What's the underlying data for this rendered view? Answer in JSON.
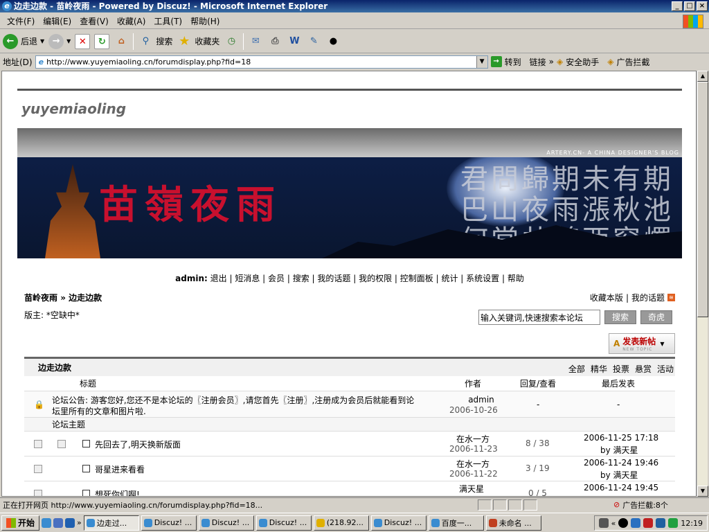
{
  "window": {
    "title": "边走边款 - 苗岭夜雨 - Powered by Discuz! - Microsoft Internet Explorer"
  },
  "menu": [
    "文件(F)",
    "编辑(E)",
    "查看(V)",
    "收藏(A)",
    "工具(T)",
    "帮助(H)"
  ],
  "toolbar": {
    "back": "后退",
    "search": "搜索",
    "favorites": "收藏夹"
  },
  "address": {
    "label": "地址(D)",
    "url": "http://www.yuyemiaoling.cn/forumdisplay.php?fid=18",
    "go": "转到",
    "links": "链接",
    "safety": "安全助手",
    "adblock": "广告拦截"
  },
  "page": {
    "logo_text": "yuyemiaoling",
    "tagline": "ARTERY.CN- A CHINA DESIGNER'S BLOG",
    "banner_title": "苗嶺夜雨",
    "banner_poem": "君問歸期未有期巴山夜雨漲秋池何當共剪西窗燭卻話巴山夜雨時",
    "nav": {
      "user": "admin:",
      "items": [
        "退出",
        "短消息",
        "会员",
        "搜索",
        "我的话题",
        "我的权限",
        "控制面板",
        "统计",
        "系统设置",
        "帮助"
      ]
    },
    "breadcrumb": {
      "home": "苗岭夜雨",
      "sep": "»",
      "current": "边走边款"
    },
    "toplinks": {
      "bookmark": "收藏本版",
      "mytopics": "我的话题"
    },
    "moderators": "版主: *空缺中*",
    "search": {
      "value": "输入关键词,快速搜索本论坛",
      "btn": "搜索",
      "btn2": "奇虎"
    },
    "newtopic": {
      "label": "发表新帖",
      "sub": "NEW TOPIC"
    },
    "forum": {
      "name": "边走边款",
      "tabs": [
        "全部",
        "精华",
        "投票",
        "悬赏",
        "活动"
      ],
      "cols": {
        "title": "标题",
        "author": "作者",
        "replies": "回复/查看",
        "last": "最后发表"
      },
      "announcement": {
        "text1": "论坛公告: 游客您好,您还不是本论坛的〖注册会员〗,请您首先〖注册〗,注册成为会员后就能看到论",
        "text2": "坛里所有的文章和图片啦.",
        "author": "admin",
        "date": "2006-10-26",
        "replies": "-",
        "last": "-"
      },
      "section": "论坛主题",
      "threads": [
        {
          "title": "先回去了,明天换新版面",
          "author": "在水一方",
          "date": "2006-11-23",
          "stats": "8 / 38",
          "last_time": "2006-11-25 17:18",
          "last_by": "by 满天星"
        },
        {
          "title": "哥星进来看看",
          "author": "在水一方",
          "date": "2006-11-22",
          "stats": "3 / 19",
          "last_time": "2006-11-24 19:46",
          "last_by": "by 满天星"
        },
        {
          "title": "想死你们啊!",
          "author": "满天星",
          "date": "",
          "stats": "0 / 5",
          "last_time": "2006-11-24 19:45",
          "last_by": ""
        }
      ]
    }
  },
  "status": {
    "text": "正在打开网页 http://www.yuyemiaoling.cn/forumdisplay.php?fid=18...",
    "adblock": "广告拦截:8个"
  },
  "taskbar": {
    "start": "开始",
    "tasks": [
      "边走过...",
      "Discuz! ...",
      "Discuz! ...",
      "Discuz! ...",
      "(218.92...",
      "Discuz! ...",
      "百度一...",
      "未命名 ..."
    ],
    "time": "12:19"
  }
}
